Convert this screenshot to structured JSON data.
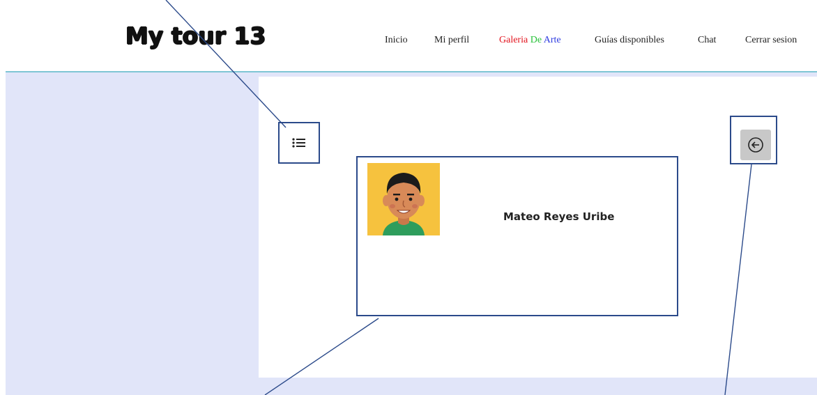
{
  "brand": {
    "logo_text": "My tour 13"
  },
  "nav": {
    "inicio": "Inicio",
    "mi_perfil": "Mi perfil",
    "galeria": {
      "part1": "Galeria",
      "part2": "De",
      "part3": "Arte"
    },
    "guias": "Guías disponibles",
    "chat": "Chat",
    "cerrar": "Cerrar sesion"
  },
  "card": {
    "name": "Mateo Reyes Uribe"
  },
  "icons": {
    "menu": "list-icon",
    "back": "arrow-left-circle-icon",
    "avatar": "avatar-illustration"
  },
  "colors": {
    "header_line": "#7fc6d4",
    "page_background": "#e1e5f9",
    "annotation": "#2b4a8a",
    "gallery_red": "#e3121c",
    "gallery_green": "#29c23a",
    "gallery_blue": "#2d3be0",
    "back_button": "#c8c8c8"
  }
}
